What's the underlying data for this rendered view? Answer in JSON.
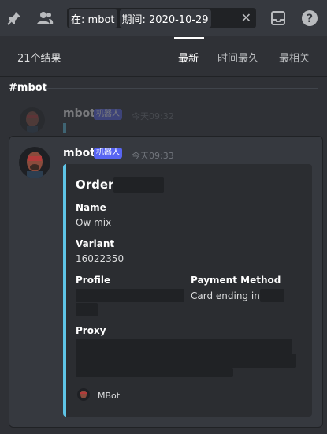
{
  "topbar": {
    "pin_icon": "pin-icon",
    "members_icon": "members-icon",
    "search": {
      "chip1_key": "在:",
      "chip1_value": "mbot",
      "chip2_key": "期间:",
      "chip2_value": "2020-10-29",
      "clear_icon": "close-icon"
    },
    "inbox_icon": "inbox-icon",
    "help_icon": "help-icon"
  },
  "results": {
    "count_label": "21个结果",
    "tabs": [
      {
        "label": "最新",
        "active": true
      },
      {
        "label": "时间最久",
        "active": false
      },
      {
        "label": "最相关",
        "active": false
      }
    ]
  },
  "channel_name": "#mbot",
  "context_message": {
    "username": "mbot",
    "bot_tag": "机器人",
    "timestamp": "今天09:32"
  },
  "message": {
    "username": "mbot",
    "bot_tag": "机器人",
    "timestamp": "今天09:33",
    "embed": {
      "accent_color": "#5ec4e6",
      "title": "Order",
      "fields": [
        {
          "name": "Name",
          "value": "Ow mix"
        },
        {
          "name": "Variant",
          "value": "16022350"
        },
        {
          "name": "Profile",
          "value": ""
        },
        {
          "name": "Payment Method",
          "value": "Card ending in"
        },
        {
          "name": "Proxy",
          "value": ""
        }
      ],
      "footer": "MBot"
    }
  }
}
